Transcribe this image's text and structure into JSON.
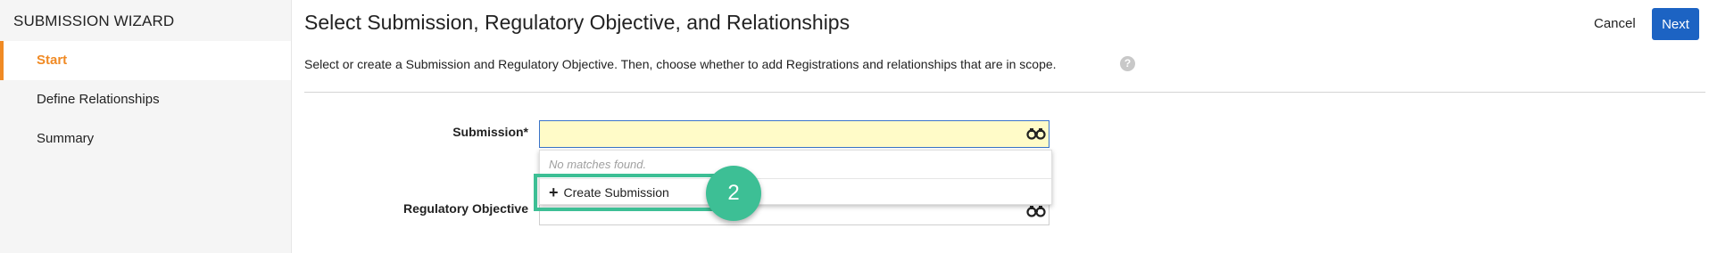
{
  "sidebar": {
    "title": "SUBMISSION WIZARD",
    "items": [
      {
        "label": "Start",
        "active": true
      },
      {
        "label": "Define Relationships",
        "active": false
      },
      {
        "label": "Summary",
        "active": false
      }
    ]
  },
  "header": {
    "title": "Select Submission, Regulatory Objective, and Relationships",
    "cancel_label": "Cancel",
    "next_label": "Next"
  },
  "instructions": "Select or create a Submission and Regulatory Objective. Then, choose whether to add Registrations and relationships that are in scope.",
  "form": {
    "submission_label": "Submission*",
    "submission_value": "",
    "regulatory_label": "Regulatory Objective",
    "regulatory_value": ""
  },
  "dropdown": {
    "no_matches": "No matches found.",
    "create_label": "Create Submission"
  },
  "annotation": {
    "step": "2"
  },
  "colors": {
    "accent": "#f08a24",
    "primary": "#1c63c3",
    "highlight": "#3dbf95",
    "input_active_bg": "#fffbc8"
  },
  "icons": {
    "help": "question-circle-icon",
    "lookup": "binoculars-icon",
    "add": "plus-icon"
  }
}
